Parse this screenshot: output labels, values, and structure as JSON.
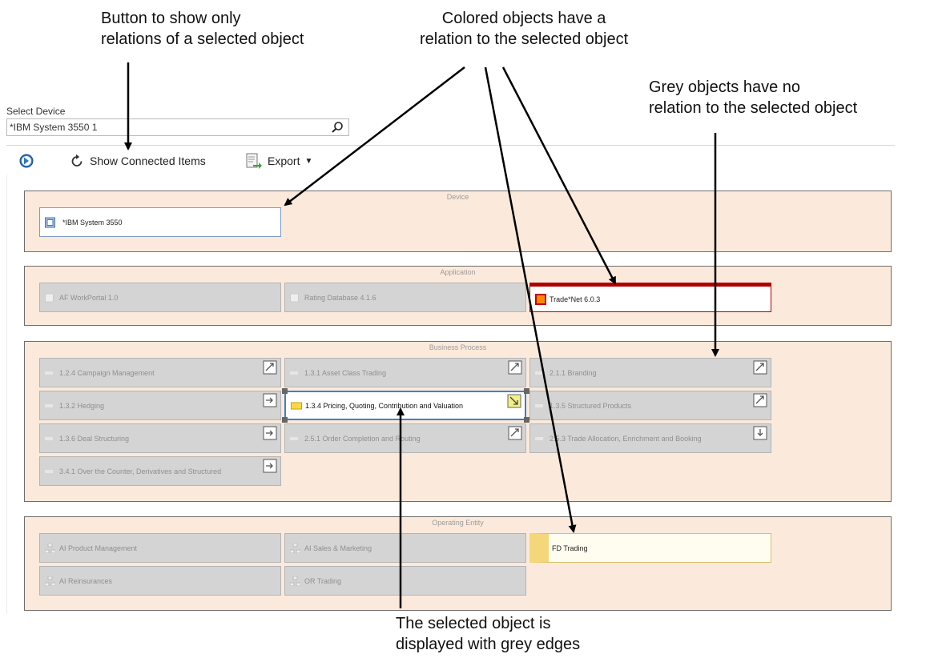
{
  "annotations": {
    "button_callout": [
      "Button to show only",
      "relations of a selected object"
    ],
    "colored_callout": [
      "Colored objects have a",
      "relation to the selected object"
    ],
    "grey_callout": [
      "Grey objects have no",
      "relation to the selected object"
    ],
    "selected_callout": [
      "The selected object is",
      "displayed with grey edges"
    ]
  },
  "device_selector": {
    "label": "Select Device",
    "value": "*IBM System 3550 1",
    "icon": "search-icon"
  },
  "toolbar": {
    "nav_icon": "arrow-circle-icon",
    "show_connected_label": "Show Connected Items",
    "export_label": "Export"
  },
  "groups": {
    "device": {
      "title": "Device",
      "nodes": [
        "*IBM System 3550"
      ]
    },
    "application": {
      "title": "Application",
      "nodes": [
        "AF WorkPortal 1.0",
        "Rating Database 4.1.6",
        "Trade*Net 6.0.3"
      ]
    },
    "business_process": {
      "title": "Business Process",
      "nodes": [
        "1.2.4 Campaign Management",
        "1.3.1 Asset Class Trading",
        "2.1.1 Branding",
        "1.3.2 Hedging",
        "1.3.4 Pricing, Quoting, Contribution and Valuation",
        "1.3.5 Structured Products",
        "1.3.6 Deal Structuring",
        "2.5.1 Order Completion and Routing",
        "2.5.3 Trade Allocation, Enrichment and Booking",
        "3.4.1 Over the Counter, Derivatives and Structured"
      ]
    },
    "operating_entity": {
      "title": "Operating Entity",
      "nodes": [
        "AI Product Management",
        "AI Sales & Marketing",
        "FD Trading",
        "AI Reinsurances",
        "OR Trading"
      ]
    }
  },
  "colors": {
    "group_bg": "#fbeadb",
    "grey_node": "#d4d4d4",
    "selected_border": "#3e7fd0",
    "trade_red": "#b00000",
    "fd_yellow": "#f3d77a"
  }
}
